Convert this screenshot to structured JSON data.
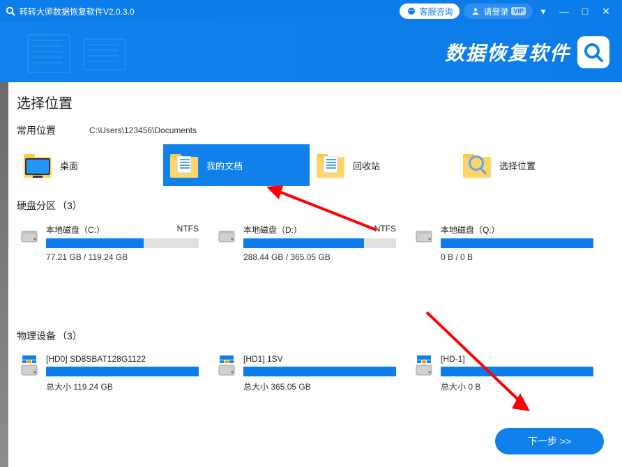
{
  "titlebar": {
    "app_title": "转转大师数据恢复软件V2.0.3.0",
    "kefu_label": "客服咨询",
    "login_label": "请登录",
    "vip_label": "VIP"
  },
  "banner": {
    "big_text": "数据恢复软件"
  },
  "section": {
    "choose_location": "选择位置",
    "common_locations_label": "常用位置",
    "current_path": "C:\\Users\\123456\\Documents",
    "partitions_label": "硬盘分区",
    "partitions_count": "（3）",
    "physical_label": "物理设备",
    "physical_count": "（3）"
  },
  "locations": {
    "desktop": "桌面",
    "documents": "我的文档",
    "recycle": "回收站",
    "choose": "选择位置"
  },
  "partitions": [
    {
      "name": "本地磁盘（C:）",
      "fs": "NTFS",
      "used_label": "77.21 GB / 119.24 GB",
      "fill_pct": 64
    },
    {
      "name": "本地磁盘（D:）",
      "fs": "NTFS",
      "used_label": "288.44 GB / 365.05 GB",
      "fill_pct": 79
    },
    {
      "name": "本地磁盘（Q:）",
      "fs": "",
      "used_label": "0 B / 0 B",
      "fill_pct": 100
    }
  ],
  "physical": [
    {
      "name": "[HD0] SD8SBAT128G1122",
      "size_label": "总大小 119.24 GB"
    },
    {
      "name": "[HD1] 1SV",
      "size_label": "总大小 365.05 GB"
    },
    {
      "name": "[HD-1]",
      "size_label": "总大小 0 B"
    }
  ],
  "next_button": "下一步 >>"
}
